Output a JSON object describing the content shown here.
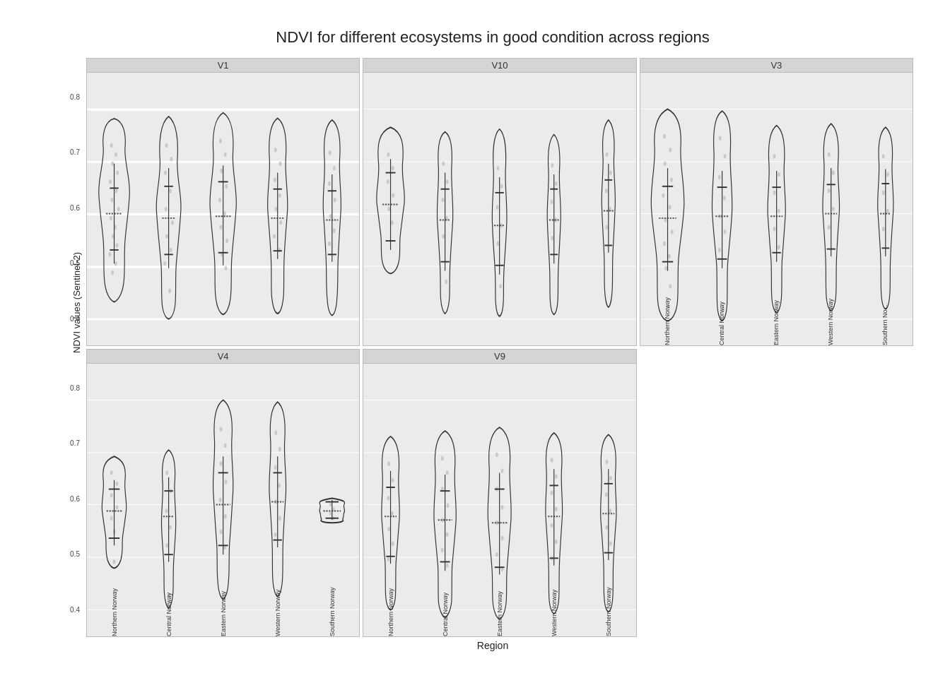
{
  "title": "NDVI for different ecosystems in good condition across regions",
  "yAxisLabel": "NDVI values (Sentinel-2)",
  "xAxisTitle": "Region",
  "regions": [
    "Northern Norway",
    "Central Norway",
    "Eastern Norway",
    "Western Norway",
    "Southern Norway"
  ],
  "facets": [
    {
      "id": "V1",
      "label": "V1"
    },
    {
      "id": "V10",
      "label": "V10"
    },
    {
      "id": "V3",
      "label": "V3"
    },
    {
      "id": "V4",
      "label": "V4"
    },
    {
      "id": "V9",
      "label": "V9"
    }
  ],
  "yTicks": [
    0.4,
    0.5,
    0.6,
    0.7,
    0.8
  ],
  "yMin": 0.35,
  "yMax": 0.87
}
